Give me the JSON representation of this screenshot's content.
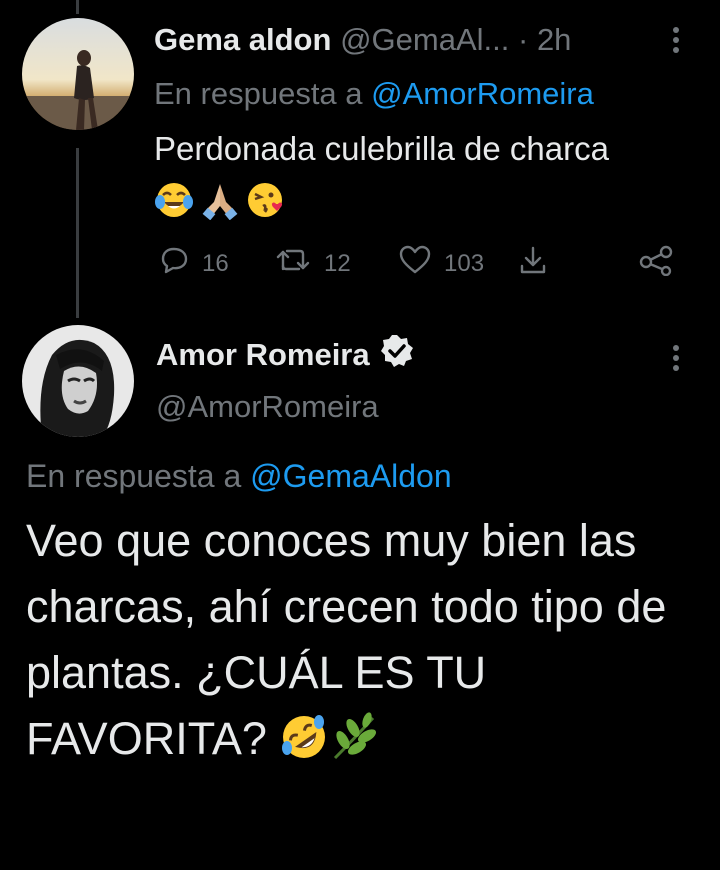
{
  "reply_tweet": {
    "author_name": "Gema aldon",
    "author_handle": "@GemaAl...",
    "separator": "·",
    "time": "2h",
    "reply_prefix": "En respuesta a",
    "reply_to": "@AmorRomeira",
    "text": "Perdonada culebrilla de charca",
    "emojis": [
      "face-with-tears-of-joy",
      "folded-hands",
      "face-blowing-kiss"
    ],
    "actions": {
      "replies": "16",
      "retweets": "12",
      "likes": "103"
    }
  },
  "main_tweet": {
    "author_name": "Amor Romeira",
    "verified": true,
    "author_handle": "@AmorRomeira",
    "reply_prefix": "En respuesta a",
    "reply_to": "@GemaAldon",
    "text": "Veo que conoces muy bien las charcas, ahí crecen todo tipo de plantas. ¿CUÁL ES TU FAVORITA?",
    "emojis": [
      "rolling-on-floor-laughing",
      "herb"
    ]
  },
  "colors": {
    "background": "#000000",
    "text": "#e7e9ea",
    "muted": "#71767b",
    "accent": "#1d9bf0"
  }
}
